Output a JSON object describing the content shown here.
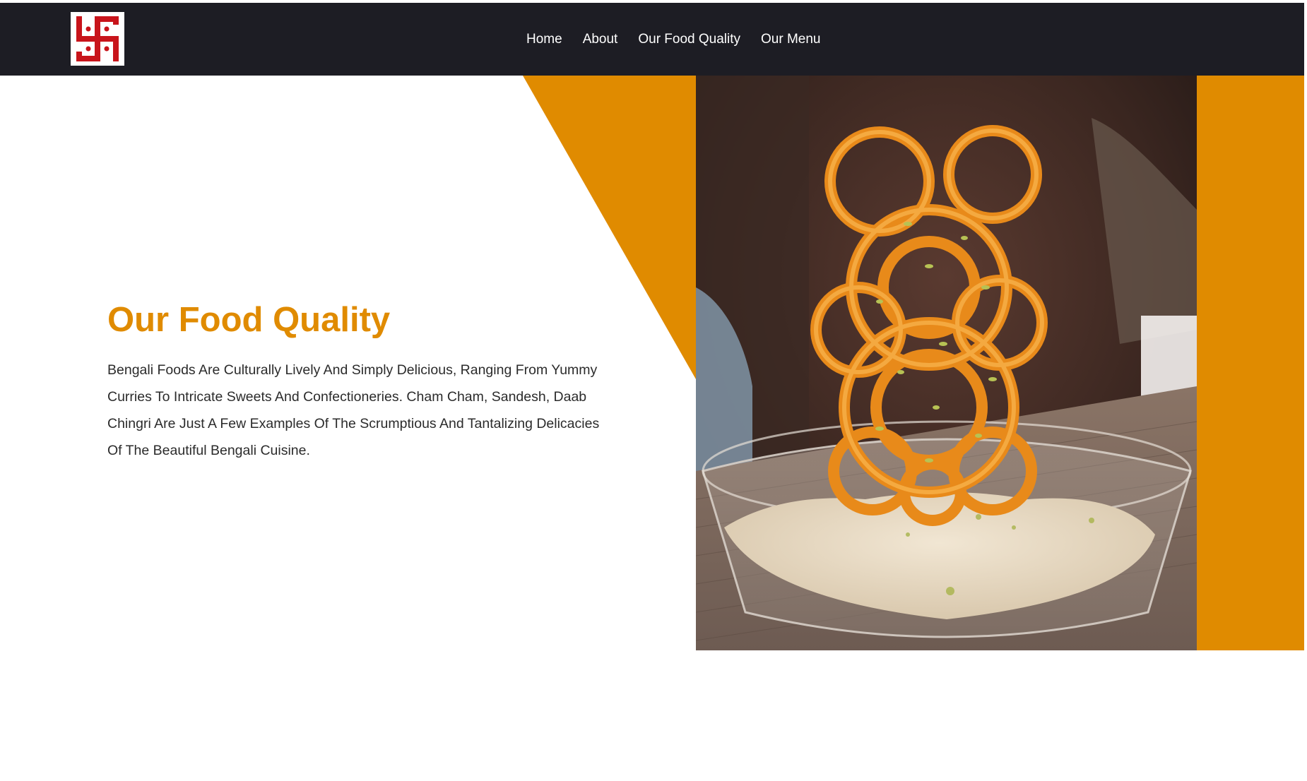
{
  "logo": {
    "icon": "swastika-icon",
    "color": "#c8141b"
  },
  "nav": {
    "items": [
      {
        "label": "Home"
      },
      {
        "label": "About"
      },
      {
        "label": "Our Food Quality"
      },
      {
        "label": "Our Menu"
      }
    ]
  },
  "hero": {
    "title": "Our Food Quality",
    "description": "Bengali Foods Are Culturally Lively And Simply Delicious, Ranging From Yummy Curries To Intricate Sweets And Confectioneries. Cham Cham, Sandesh, Daab Chingri Are Just A Few Examples Of The Scrumptious And Tantalizing Delicacies Of The Beautiful Bengali Cuisine.",
    "image_subject": "jalebi-with-rabri-dessert"
  },
  "colors": {
    "navbar": "#1d1d24",
    "accent": "#e08b00",
    "text": "#2b2b2b",
    "nav_text": "#ffffff"
  }
}
